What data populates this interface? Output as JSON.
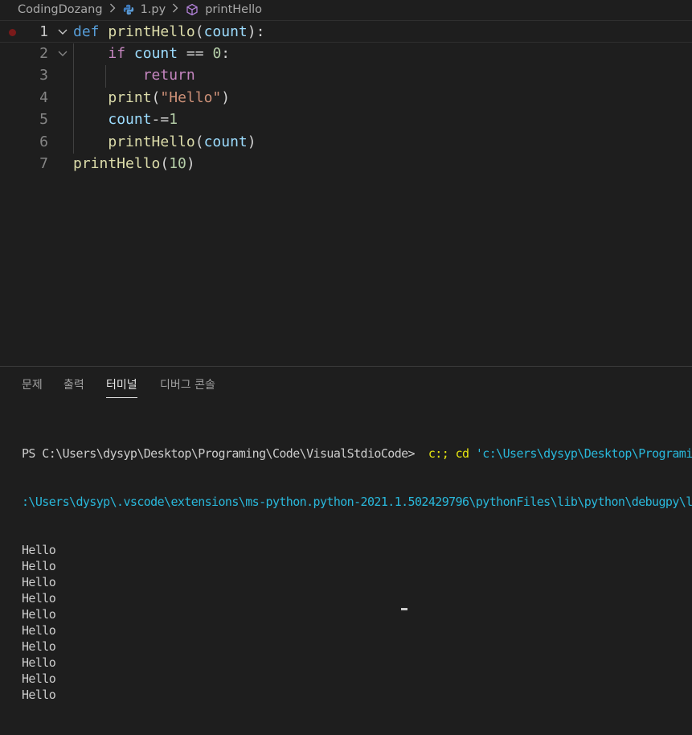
{
  "breadcrumb": {
    "folder": "CodingDozang",
    "file": "1.py",
    "symbol": "printHello",
    "separator": ">"
  },
  "editor": {
    "line_numbers": [
      "1",
      "2",
      "3",
      "4",
      "5",
      "6",
      "7"
    ],
    "lines": [
      [
        {
          "t": "def",
          "c": "kw-blue"
        },
        {
          "t": " ",
          "c": "plain"
        },
        {
          "t": "printHello",
          "c": "fn"
        },
        {
          "t": "(",
          "c": "plain"
        },
        {
          "t": "count",
          "c": "param"
        },
        {
          "t": "):",
          "c": "plain"
        }
      ],
      [
        {
          "t": "    ",
          "c": "plain"
        },
        {
          "t": "if",
          "c": "kw-purple"
        },
        {
          "t": " ",
          "c": "plain"
        },
        {
          "t": "count",
          "c": "param"
        },
        {
          "t": " == ",
          "c": "plain"
        },
        {
          "t": "0",
          "c": "num"
        },
        {
          "t": ":",
          "c": "plain"
        }
      ],
      [
        {
          "t": "        ",
          "c": "plain"
        },
        {
          "t": "return",
          "c": "kw-purple"
        }
      ],
      [
        {
          "t": "    ",
          "c": "plain"
        },
        {
          "t": "print",
          "c": "fn"
        },
        {
          "t": "(",
          "c": "plain"
        },
        {
          "t": "\"Hello\"",
          "c": "str"
        },
        {
          "t": ")",
          "c": "plain"
        }
      ],
      [
        {
          "t": "    ",
          "c": "plain"
        },
        {
          "t": "count",
          "c": "param"
        },
        {
          "t": "-=",
          "c": "plain"
        },
        {
          "t": "1",
          "c": "num"
        }
      ],
      [
        {
          "t": "    ",
          "c": "plain"
        },
        {
          "t": "printHello",
          "c": "fn"
        },
        {
          "t": "(",
          "c": "plain"
        },
        {
          "t": "count",
          "c": "param"
        },
        {
          "t": ")",
          "c": "plain"
        }
      ],
      [
        {
          "t": "printHello",
          "c": "fn"
        },
        {
          "t": "(",
          "c": "plain"
        },
        {
          "t": "10",
          "c": "num"
        },
        {
          "t": ")",
          "c": "plain"
        }
      ]
    ]
  },
  "panel": {
    "tabs": [
      {
        "label": "문제",
        "active": false
      },
      {
        "label": "출력",
        "active": false
      },
      {
        "label": "터미널",
        "active": true
      },
      {
        "label": "디버그 콘솔",
        "active": false
      }
    ]
  },
  "terminal": {
    "prompt": "PS C:\\Users\\dysyp\\Desktop\\Programing\\Code\\VisualStdioCode> ",
    "command_1": " c:; cd ",
    "command_path": "'c:\\Users\\dysyp\\Desktop\\Programing\\Code\\VisualStdioCode'",
    "line_2": ":\\Users\\dysyp\\.vscode\\extensions\\ms-python.python-2021.1.502429796\\pythonFiles\\lib\\python\\debugpy\\launcher",
    "output": [
      "Hello",
      "Hello",
      "Hello",
      "Hello",
      "Hello",
      "Hello",
      "Hello",
      "Hello",
      "Hello",
      "Hello"
    ]
  },
  "colors": {
    "background": "#1e1e1e",
    "keyword_blue": "#569cd6",
    "keyword_purple": "#c586c0",
    "function": "#dcdcaa",
    "variable": "#9cdcfe",
    "number": "#b5cea8",
    "string": "#ce9178",
    "breakpoint": "#7a1a1a"
  }
}
